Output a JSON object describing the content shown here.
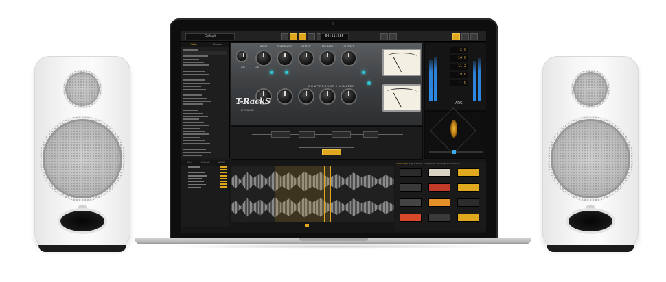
{
  "scene": {
    "colors": {
      "speaker_body": "#f4f4f4",
      "grille": "#bdbdbd",
      "laptop_frame": "#0e0e0e",
      "ui_background": "#1a1a1a",
      "accent": "#e0a81e",
      "meter_blue": "#2b8ae6",
      "led_cyan": "#36e0f0"
    }
  },
  "app": {
    "preset_name": "Default",
    "time_display": "00:11:285",
    "sidebar_tabs": [
      "Folder",
      "Module"
    ],
    "rack_title": "T-RackS",
    "rack_subtitle": "DYNA-MU",
    "rack_section_label": "COMPRESSOR / LIMITER",
    "knob_labels": [
      "INPUT",
      "THRESHOLD",
      "ATTACK",
      "RELEASE",
      "OUTPUT"
    ],
    "link_label": "L/R",
    "mode_label": "M/S",
    "arc_label": "ARC",
    "meter_readouts": [
      "-2.0",
      "-14.0",
      "-11.2",
      "-9.0",
      "-7.0"
    ],
    "bottom_tabs": [
      "MIX",
      "MIXLAB",
      "WAVE"
    ],
    "module_tabs": [
      "DYNAMICS",
      "EQUALIZERS",
      "MASTERING",
      "REVERB",
      "SATURATION"
    ]
  }
}
